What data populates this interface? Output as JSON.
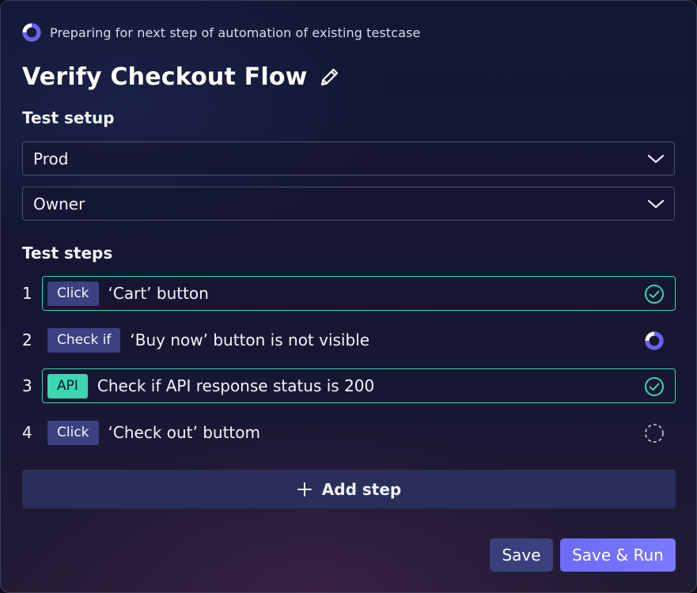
{
  "status": {
    "text": "Preparing for next step of automation of existing testcase",
    "icon": "progress-spinner-icon"
  },
  "header": {
    "title": "Verify Checkout Flow",
    "edit_icon": "pencil-icon"
  },
  "setup": {
    "label": "Test setup",
    "environment": "Prod",
    "role": "Owner"
  },
  "steps": {
    "label": "Test steps",
    "items": [
      {
        "number": "1",
        "badge": "Click",
        "text": "‘Cart’ button",
        "state": "done"
      },
      {
        "number": "2",
        "badge": "Check if",
        "text": "‘Buy now’ button is not visible",
        "state": "in-progress"
      },
      {
        "number": "3",
        "badge": "API",
        "text": "Check if API response status is 200",
        "state": "done"
      },
      {
        "number": "4",
        "badge": "Click",
        "text": "‘Check out’ buttom",
        "state": "pending"
      }
    ]
  },
  "actions": {
    "add_step": "Add step",
    "save": "Save",
    "save_run": "Save & Run"
  },
  "colors": {
    "accent": "#7a78ff",
    "success": "#3ed3b0",
    "badge": "#3c4180",
    "api_badge": "#3cd6b0"
  }
}
